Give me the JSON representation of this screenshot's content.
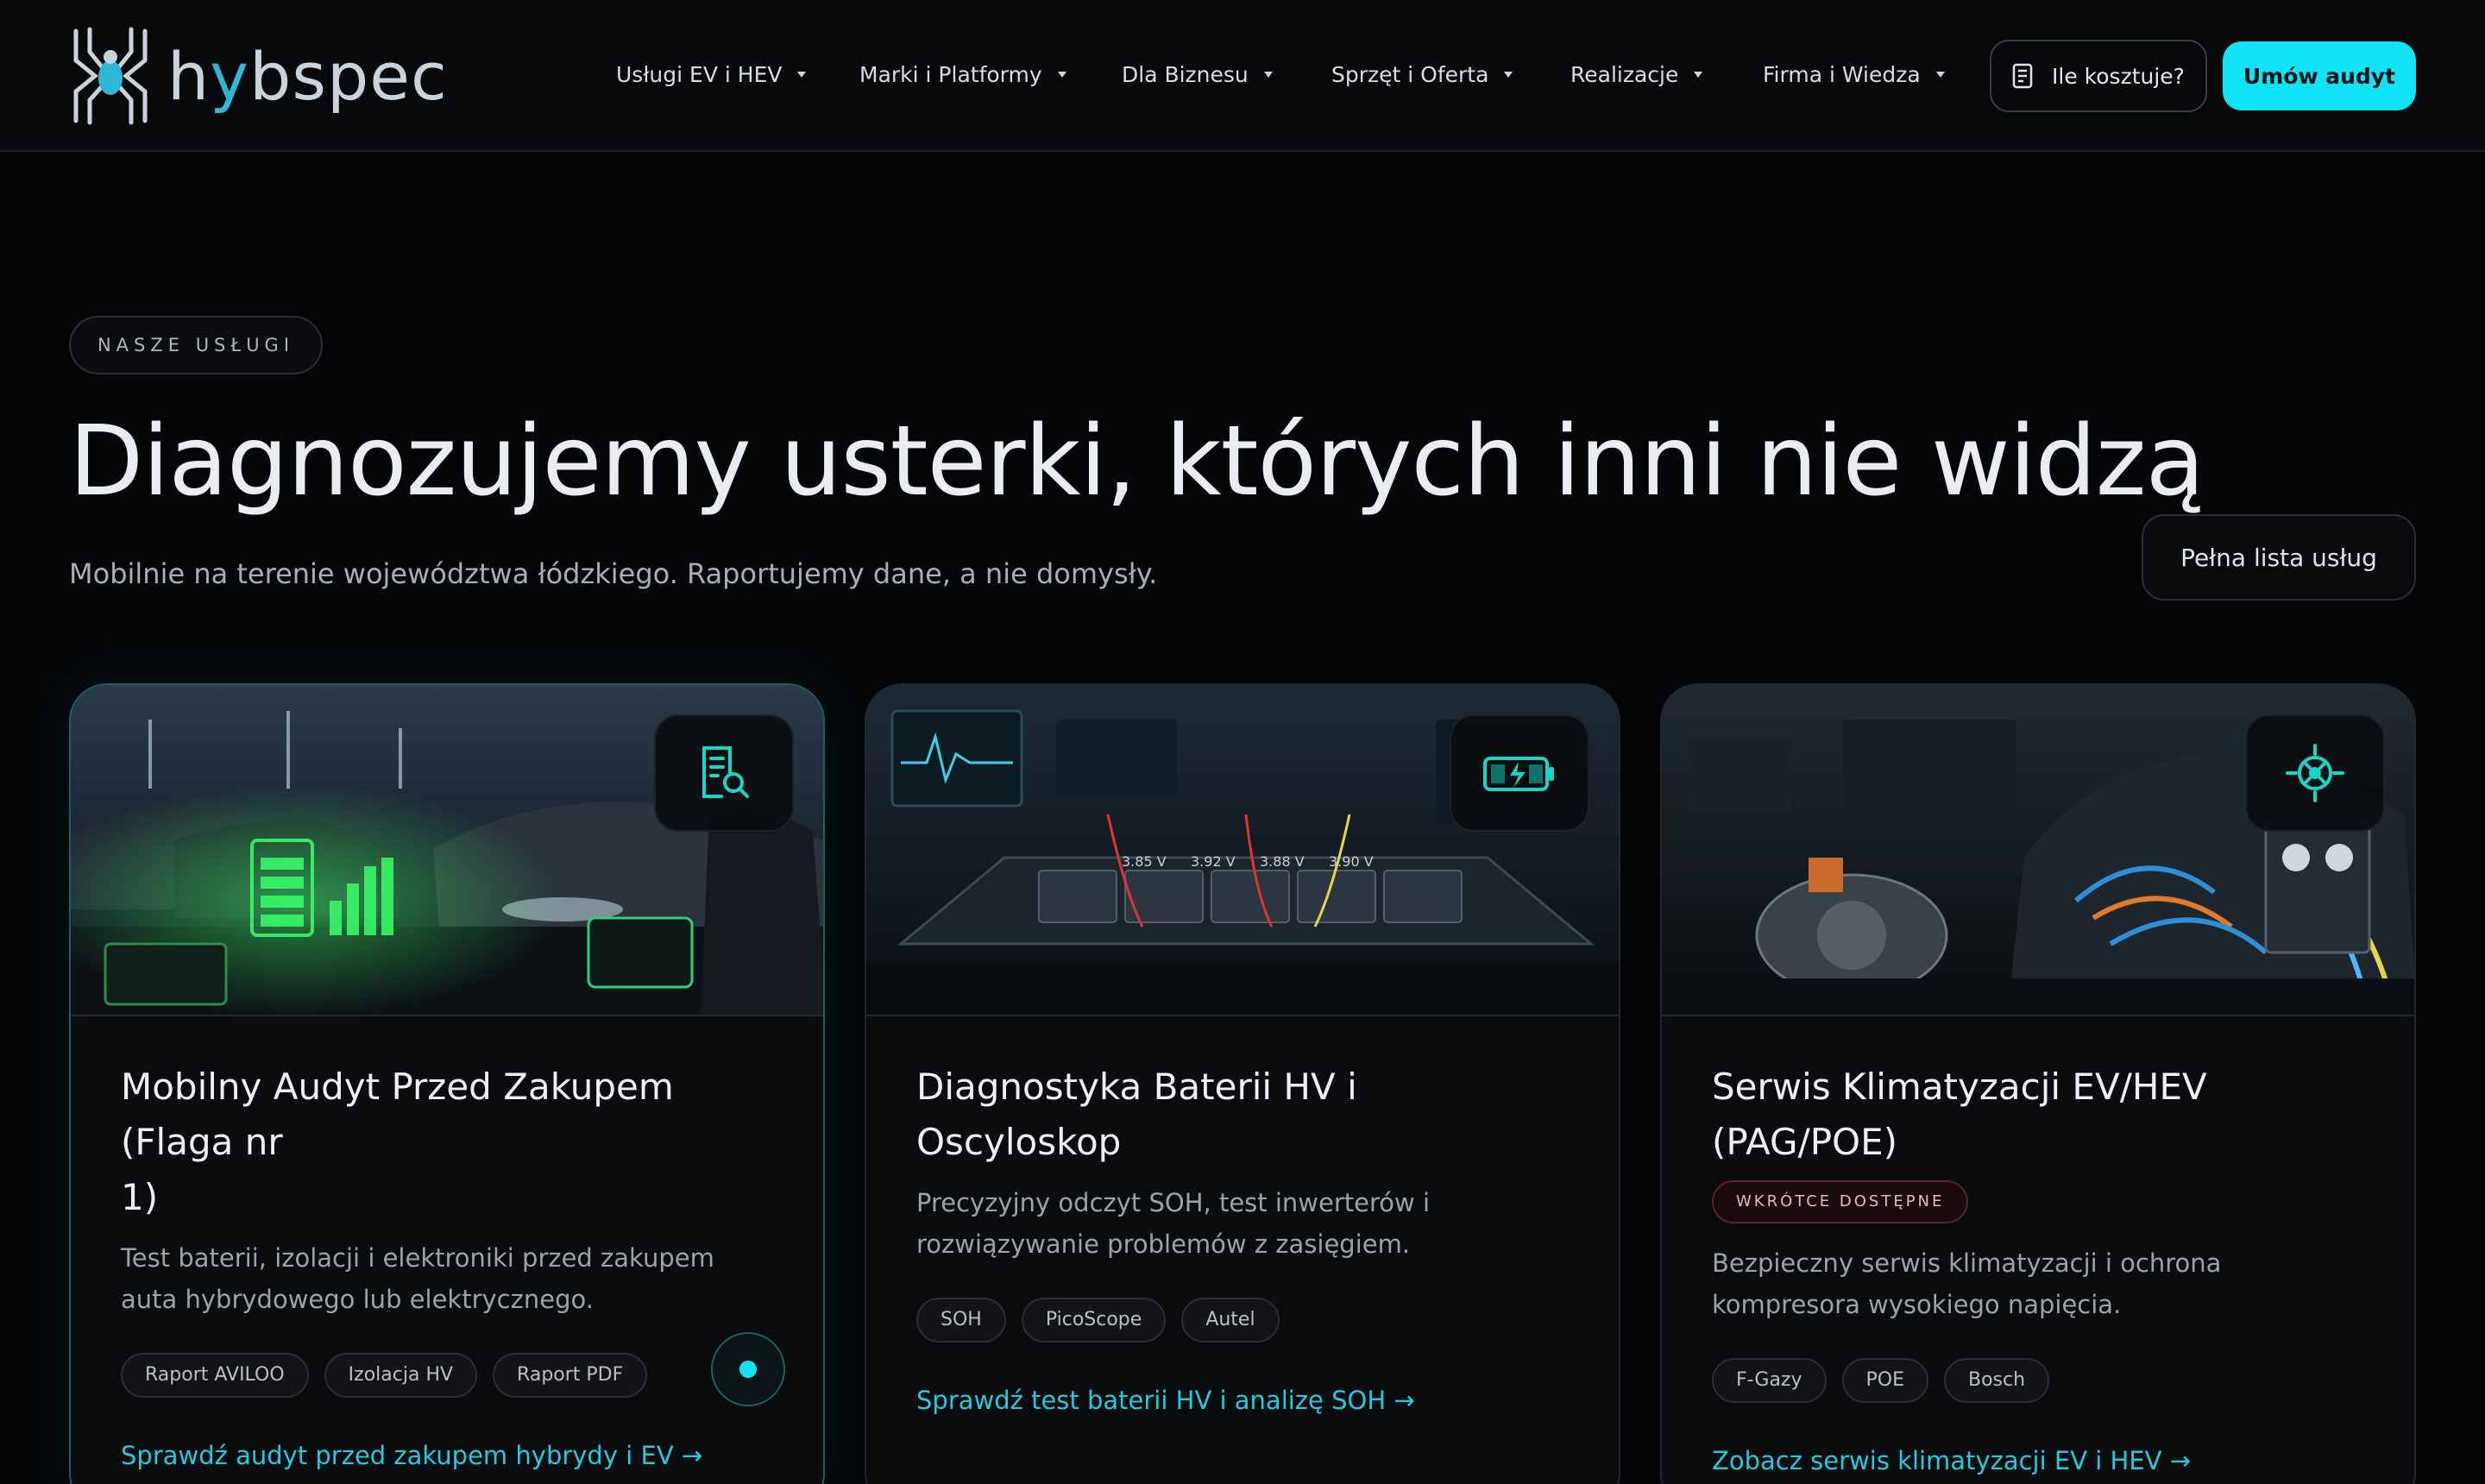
{
  "brand": {
    "logo_name": "hybspec-logo",
    "text_pre": "h",
    "text_y": "y",
    "text_post": "bspec"
  },
  "nav": {
    "items": [
      {
        "label": "Usługi EV i HEV"
      },
      {
        "label": "Marki i Platformy"
      },
      {
        "label": "Dla Biznesu"
      },
      {
        "label": "Sprzęt i Oferta"
      },
      {
        "label": "Realizacje"
      },
      {
        "label": "Firma i Wiedza"
      }
    ],
    "price_button": "Ile kosztuje?",
    "cta_button": "Umów audyt"
  },
  "hero": {
    "section_label": "NASZE USŁUGI",
    "title": "Diagnozujemy usterki, których inni nie widzą",
    "subtitle": "Mobilnie na terenie województwa łódzkiego. Raportujemy dane, a nie domysły.",
    "all_services_button": "Pełna lista usług"
  },
  "cards": [
    {
      "title_line1": "Mobilny Audyt Przed Zakupem (Flaga nr",
      "title_line2": "1)",
      "description": "Test baterii, izolacji i elektroniki przed zakupem auta hybrydowego lub elektrycznego.",
      "tags": [
        "Raport AVILOO",
        "Izolacja HV",
        "Raport PDF"
      ],
      "link": "Sprawdź audyt przed zakupem hybrydy i EV →",
      "icon": "report-search-icon"
    },
    {
      "title": "Diagnostyka Baterii HV i Oscyloskop",
      "description": "Precyzyjny odczyt SOH, test inwerterów i rozwiązywanie problemów z zasięgiem.",
      "tags": [
        "SOH",
        "PicoScope",
        "Autel"
      ],
      "link": "Sprawdź test baterii HV i analizę SOH →",
      "icon": "battery-charge-icon",
      "voltages": [
        "3.85 V",
        "3.92 V",
        "3.88 V",
        "3.90 V"
      ]
    },
    {
      "title": "Serwis Klimatyzacji EV/HEV (PAG/POE)",
      "badge": "WKRÓTCE DOSTĘPNE",
      "description": "Bezpieczny serwis klimatyzacji i ochrona kompresora wysokiego napięcia.",
      "tags": [
        "F-Gazy",
        "POE",
        "Bosch"
      ],
      "link": "Zobacz serwis klimatyzacji EV i HEV →",
      "icon": "ac-fan-icon"
    }
  ],
  "colors": {
    "accent": "#10e3f6",
    "link": "#25c9de",
    "background": "#040506"
  }
}
